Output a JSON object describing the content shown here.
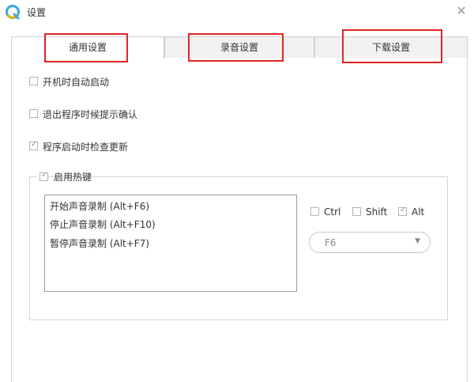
{
  "window": {
    "title": "设置",
    "close_glyph": "✕"
  },
  "tabs": [
    {
      "label": "通用设置",
      "active": true
    },
    {
      "label": "录音设置",
      "active": false
    },
    {
      "label": "下载设置",
      "active": false
    }
  ],
  "options": [
    {
      "label": "开机时自动启动",
      "checked": false
    },
    {
      "label": "退出程序时候提示确认",
      "checked": false
    },
    {
      "label": "程序启动时检查更新",
      "checked": true
    }
  ],
  "hotkeys": {
    "enable_label": "启用热键",
    "enabled": true,
    "list": [
      {
        "label": "开始声音录制 (Alt+F6)"
      },
      {
        "label": "停止声音录制 (Alt+F10)"
      },
      {
        "label": "暂停声音录制 (Alt+F7)"
      }
    ],
    "modifiers": [
      {
        "label": "Ctrl",
        "checked": false
      },
      {
        "label": "Shift",
        "checked": false
      },
      {
        "label": "Alt",
        "checked": true
      }
    ],
    "key_select": {
      "value": "F6"
    }
  },
  "colors": {
    "annotation_red": "#e02424",
    "check_green": "#7fae5d",
    "tab_inactive_bg": "#f1f1f1"
  },
  "icons": {
    "logo": "app-logo-icon",
    "close": "close-icon",
    "check": "check-icon",
    "dropdown": "chevron-down-icon"
  }
}
